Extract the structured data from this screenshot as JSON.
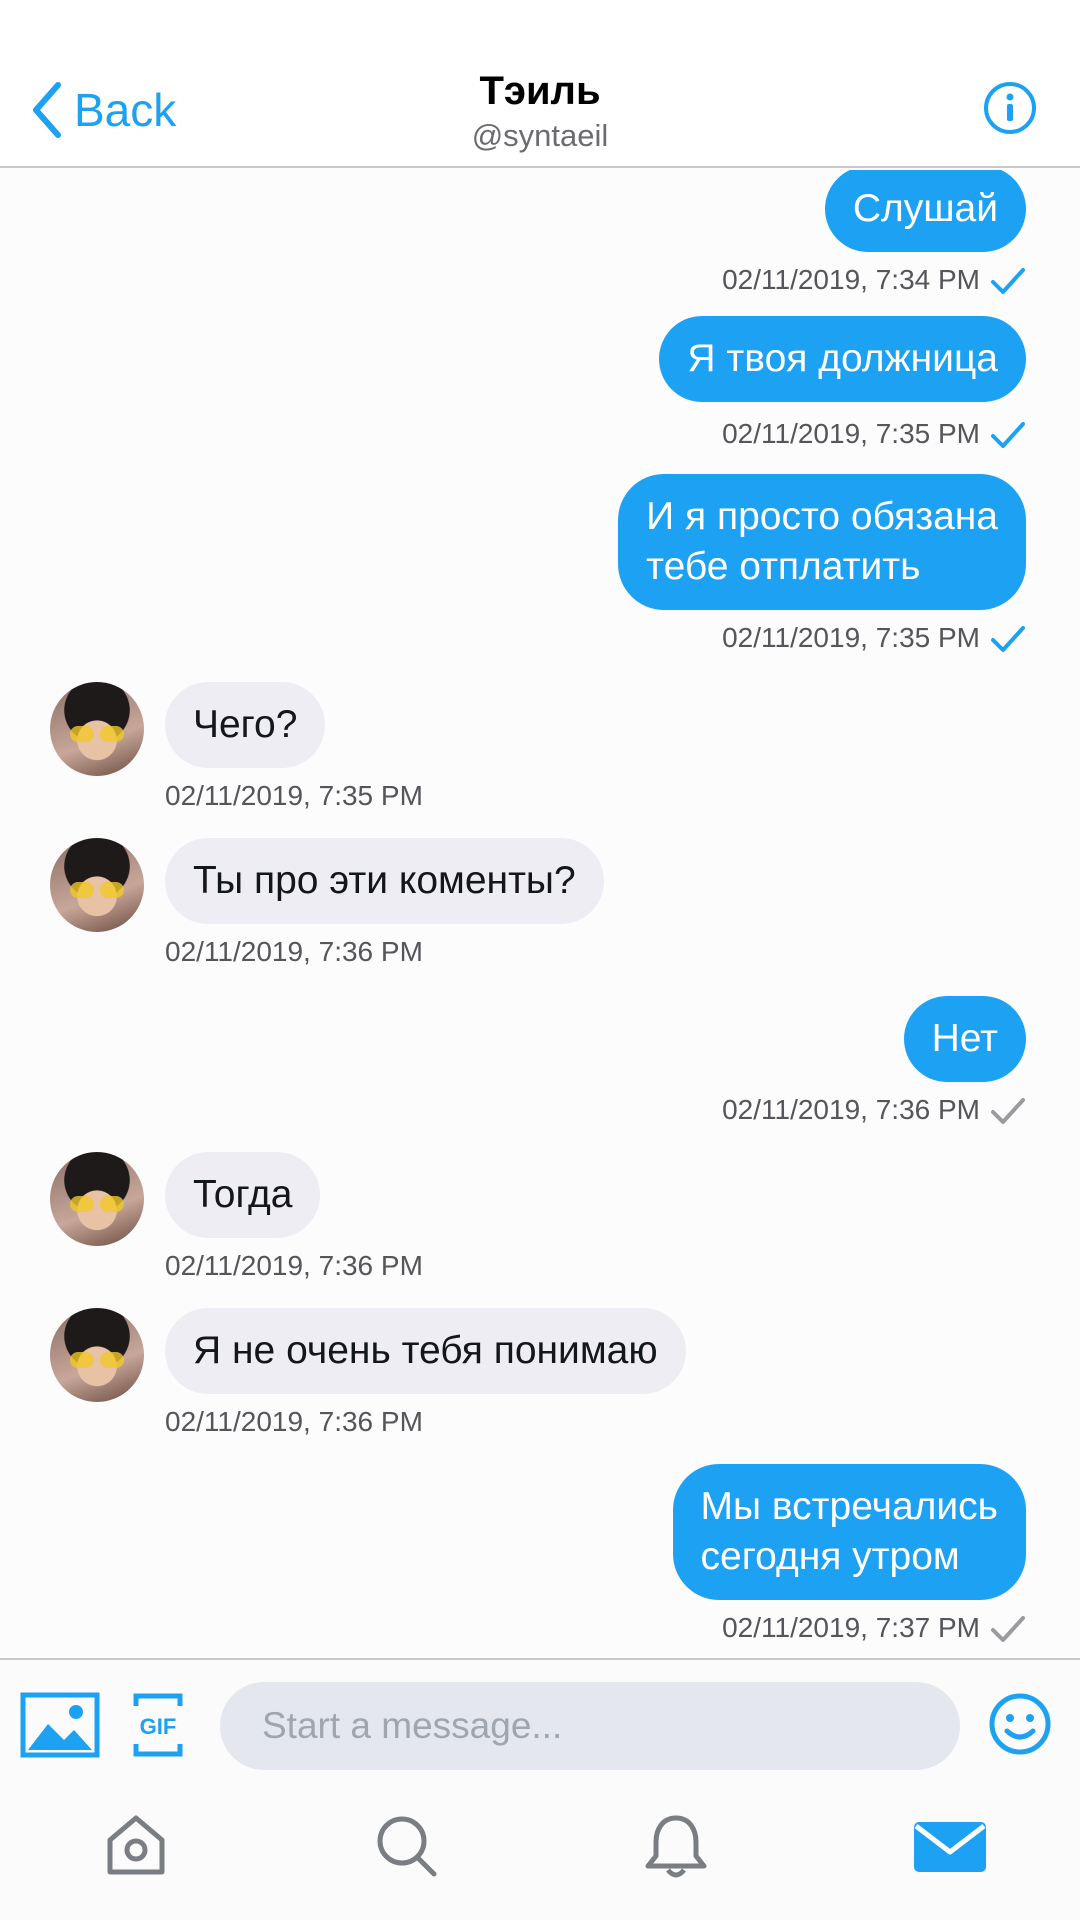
{
  "header": {
    "back_label": "Back",
    "title": "Тэиль",
    "subtitle": "@syntaeil"
  },
  "messages": [
    {
      "direction": "out",
      "text": "Слушай",
      "timestamp": "02/11/2019, 7:34 PM",
      "read": true
    },
    {
      "direction": "out",
      "text": "Я твоя должница",
      "timestamp": "02/11/2019, 7:35 PM",
      "read": true
    },
    {
      "direction": "out",
      "lines": [
        "И я просто обязана",
        "тебе отплатить"
      ],
      "timestamp": "02/11/2019, 7:35 PM",
      "read": true
    },
    {
      "direction": "in",
      "text": "Чего?",
      "timestamp": "02/11/2019, 7:35 PM"
    },
    {
      "direction": "in",
      "text": "Ты про эти коменты?",
      "timestamp": "02/11/2019, 7:36 PM"
    },
    {
      "direction": "out",
      "text": "Нет",
      "timestamp": "02/11/2019, 7:36 PM",
      "read": false
    },
    {
      "direction": "in",
      "text": "Тогда",
      "timestamp": "02/11/2019, 7:36 PM"
    },
    {
      "direction": "in",
      "text": "Я не очень тебя понимаю",
      "timestamp": "02/11/2019, 7:36 PM"
    },
    {
      "direction": "out",
      "lines": [
        "Мы встречались",
        "сегодня утром"
      ],
      "timestamp": "02/11/2019, 7:37 PM",
      "read": false
    }
  ],
  "composer": {
    "placeholder": "Start a message...",
    "gif_label": "GIF"
  },
  "colors": {
    "accent": "#1da1f2",
    "incoming_bubble": "#eeedf3",
    "read_check": "#1da1f2",
    "sent_check": "#9a9a9f"
  },
  "icons": {
    "back": "chevron-left-icon",
    "info": "info-icon",
    "image": "image-icon",
    "gif": "gif-icon",
    "emoji": "emoji-icon",
    "home": "home-icon",
    "search": "search-icon",
    "notifications": "bell-icon",
    "messages": "mail-icon"
  }
}
